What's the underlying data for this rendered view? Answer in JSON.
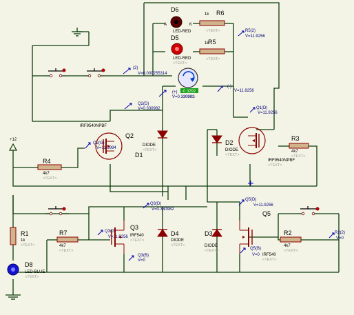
{
  "colors": {
    "background": "#f4f4e6",
    "wire": "#0a3b0a",
    "component": "#8b0000",
    "probe": "#00007a",
    "led_red": "#d00000",
    "led_blue": "#1414d0",
    "motor_label": "#1a9e1a"
  },
  "components": {
    "d6": {
      "ref": "D6",
      "pinA": "A",
      "pinK": "K",
      "type": "LED-RED"
    },
    "d5": {
      "ref": "D5",
      "type": "LED-RED",
      "text": "<TEXT>"
    },
    "r6": {
      "ref": "R6",
      "value": "1k",
      "text": "<TEXT>"
    },
    "r5": {
      "ref": "R5",
      "value": "1k",
      "text": "<TEXT>"
    },
    "motor": {
      "value": "-0.3292",
      "text": "<TEXT>"
    },
    "q2": {
      "ref": "Q2",
      "type": "IRF9540NPBF"
    },
    "d1": {
      "ref": "D1",
      "type": "DIODE",
      "text": "<TEXT>"
    },
    "d2": {
      "ref": "D2",
      "type": "DIODE",
      "text": "<TEXT>"
    },
    "q1": {
      "ref": "Q1",
      "type": "IRF9540NPBF",
      "text": "<TEXT>"
    },
    "r3": {
      "ref": "R3",
      "value": "4k7",
      "text": "<TEXT>"
    },
    "r4": {
      "ref": "R4",
      "value": "4k7",
      "text": "<TEXT>"
    },
    "power": {
      "label": "+12"
    },
    "r1": {
      "ref": "R1",
      "value": "1k",
      "text": "<TEXT>"
    },
    "d8": {
      "ref": "D8",
      "type": "LED-BLUE",
      "text": "<TEXT>"
    },
    "r7": {
      "ref": "R7",
      "value": "4k7",
      "text": "<TEXT>"
    },
    "q3": {
      "ref": "Q3",
      "type": "IRF540",
      "text": "<TEXT>"
    },
    "d4": {
      "ref": "D4",
      "type": "DIODE",
      "text": "<TEXT>"
    },
    "d3": {
      "ref": "D3",
      "type": "DIODE",
      "text": "<TEXT>"
    },
    "q5": {
      "ref": "Q5",
      "type": "IRF540",
      "text": "<TEXT>"
    },
    "r2": {
      "ref": "R2",
      "value": "4k7",
      "text": "<TEXT>"
    }
  },
  "probes": {
    "p2": {
      "name": "(2)",
      "value": "V=0.000255314"
    },
    "r5_2": {
      "name": "R5(2)",
      "value": "V=11.9256"
    },
    "plus": {
      "name": "(+)",
      "value": "V=0.330982"
    },
    "minus": {
      "name": "(-)",
      "value": "V=11.9256"
    },
    "q2d": {
      "name": "Q2(D)",
      "value": "V=0.330982"
    },
    "q2g": {
      "name": "Q2(G)",
      "value": "V=11.9994"
    },
    "q1d": {
      "name": "Q1(D)",
      "value": "V=11.9256"
    },
    "q3d": {
      "name": "Q3(D)",
      "value": "V=0.330982"
    },
    "q3g": {
      "name": "Q3(G)",
      "value": "V=11.9256"
    },
    "q3b": {
      "name": "Q3(B)",
      "value": "V=0"
    },
    "q5d": {
      "name": "Q5(D)",
      "value": "V=11.9256"
    },
    "q5b": {
      "name": "Q5(B)",
      "value": "V=0"
    },
    "r2_2": {
      "name": "R2(2)",
      "value": "V=0"
    }
  }
}
